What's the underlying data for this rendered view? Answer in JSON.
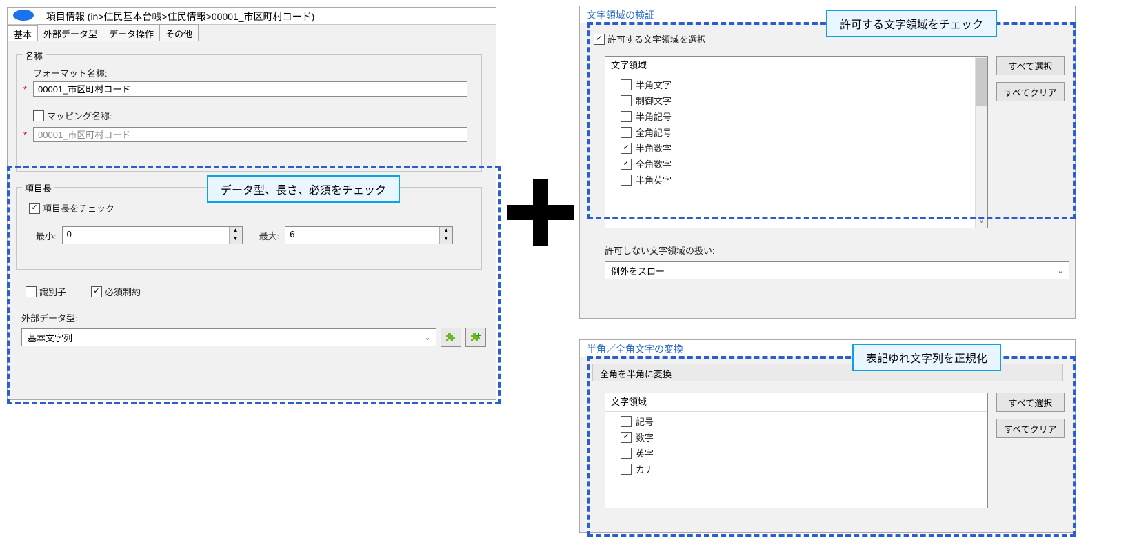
{
  "callouts": {
    "left": "データ型、長さ、必須をチェック",
    "right_top": "許可する文字領域をチェック",
    "right_bottom": "表記ゆれ文字列を正規化"
  },
  "leftPanel": {
    "title": "項目情報 (in>住民基本台帳>住民情報>00001_市区町村コード)",
    "tabs": [
      "基本",
      "外部データ型",
      "データ操作",
      "その他"
    ],
    "name_group": {
      "legend": "名称",
      "format_label": "フォーマット名称:",
      "format_value": "00001_市区町村コード",
      "mapping_cb_label": "マッピング名称:",
      "mapping_cb_checked": false,
      "mapping_value": "00001_市区町村コード"
    },
    "len_group": {
      "legend": "項目長",
      "check_label": "項目長をチェック",
      "check_checked": true,
      "min_label": "最小:",
      "min_value": "0",
      "max_label": "最大:",
      "max_value": "6"
    },
    "id_cb": {
      "label": "識別子",
      "checked": false
    },
    "req_cb": {
      "label": "必須制約",
      "checked": true
    },
    "ext_label": "外部データ型:",
    "ext_value": "基本文字列"
  },
  "validationPanel": {
    "title": "文字領域の検証",
    "allow_cb": {
      "label": "許可する文字領域を選択",
      "checked": true
    },
    "list_header": "文字領域",
    "items": [
      {
        "label": "半角文字",
        "checked": false
      },
      {
        "label": "制御文字",
        "checked": false
      },
      {
        "label": "半角記号",
        "checked": false
      },
      {
        "label": "全角記号",
        "checked": false
      },
      {
        "label": "半角数字",
        "checked": true
      },
      {
        "label": "全角数字",
        "checked": true
      },
      {
        "label": "半角英字",
        "checked": false
      }
    ],
    "select_all": "すべて選択",
    "clear_all": "すべてクリア",
    "deny_label": "許可しない文字領域の扱い:",
    "deny_value": "例外をスロー"
  },
  "convertPanel": {
    "title": "半角／全角文字の変換",
    "sub_header": "全角を半角に変換",
    "list_header": "文字領域",
    "items": [
      {
        "label": "記号",
        "checked": false
      },
      {
        "label": "数字",
        "checked": true
      },
      {
        "label": "英字",
        "checked": false
      },
      {
        "label": "カナ",
        "checked": false
      }
    ],
    "select_all": "すべて選択",
    "clear_all": "すべてクリア"
  }
}
